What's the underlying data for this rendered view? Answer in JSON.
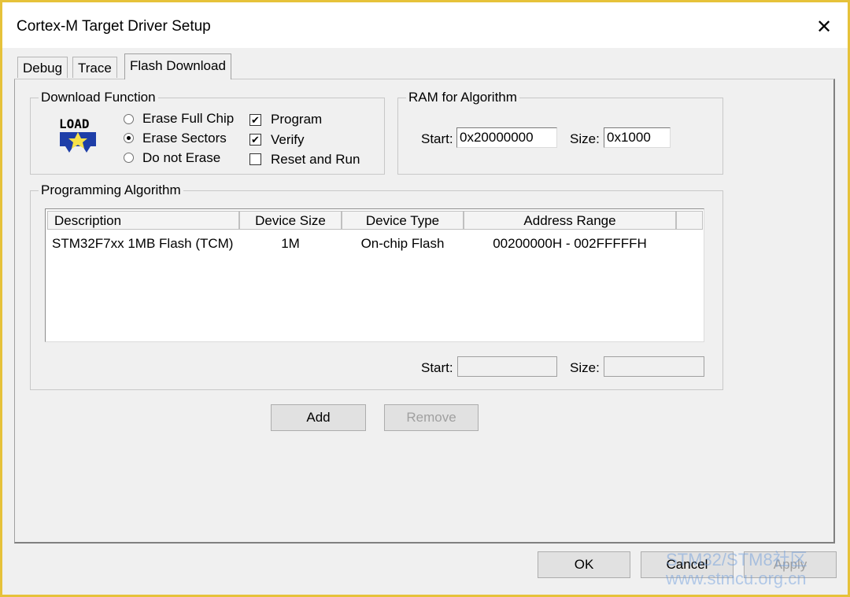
{
  "window": {
    "title": "Cortex-M Target Driver Setup"
  },
  "tabs": [
    "Debug",
    "Trace",
    "Flash Download"
  ],
  "download_function": {
    "label": "Download Function",
    "icon_text": "LOAD",
    "radios": [
      "Erase Full Chip",
      "Erase Sectors",
      "Do not Erase"
    ],
    "selected_radio": "Erase Sectors",
    "checks": [
      {
        "label": "Program",
        "checked": true
      },
      {
        "label": "Verify",
        "checked": true
      },
      {
        "label": "Reset and Run",
        "checked": false
      }
    ]
  },
  "ram": {
    "label": "RAM for Algorithm",
    "start_label": "Start:",
    "start_value": "0x20000000",
    "size_label": "Size:",
    "size_value": "0x1000"
  },
  "programming": {
    "label": "Programming Algorithm",
    "columns": [
      "Description",
      "Device Size",
      "Device Type",
      "Address Range"
    ],
    "rows": [
      [
        "STM32F7xx 1MB Flash (TCM)",
        "1M",
        "On-chip Flash",
        "00200000H - 002FFFFFH"
      ]
    ],
    "start_label": "Start:",
    "start_value": "",
    "size_label": "Size:",
    "size_value": ""
  },
  "buttons": {
    "add": "Add",
    "remove": "Remove",
    "ok": "OK",
    "cancel": "Cancel",
    "apply": "Apply"
  },
  "watermark": {
    "line1": "STM32/STM8社区",
    "line2": "www.stmcu.org.cn"
  }
}
